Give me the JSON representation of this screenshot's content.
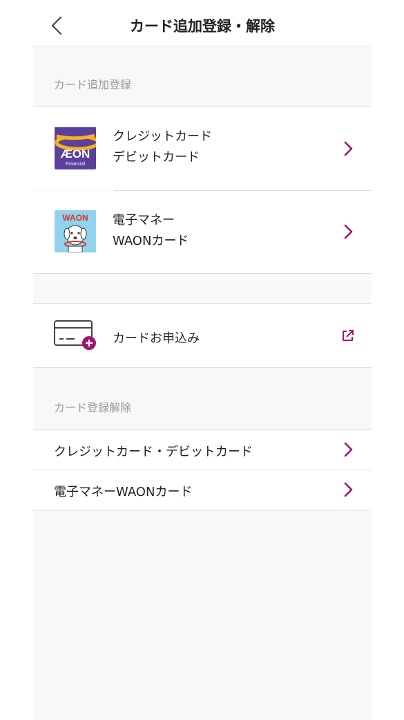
{
  "header": {
    "title": "カード追加登録・解除"
  },
  "add_section": {
    "label": "カード追加登録",
    "items": [
      {
        "line1": "クレジットカード",
        "line2": "デビットカード",
        "icon": "aeon-financial-logo-icon",
        "logo_text": "ÆON",
        "logo_sub": "Financial"
      },
      {
        "line1": "電子マネー",
        "line2": "WAONカード",
        "icon": "waon-dog-logo-icon",
        "logo_text": "WAON"
      }
    ]
  },
  "apply": {
    "label": "カードお申込み",
    "icon": "card-add-icon",
    "action_icon": "external-link-icon"
  },
  "remove_section": {
    "label": "カード登録解除",
    "items": [
      {
        "label": "クレジットカード・デビットカード"
      },
      {
        "label": "電子マネーWAONカード"
      }
    ]
  },
  "colors": {
    "accent": "#a0146e",
    "aeon_purple": "#5b3f9c",
    "aeon_gold": "#f2b41a",
    "waon_blue": "#8fd3ee"
  }
}
